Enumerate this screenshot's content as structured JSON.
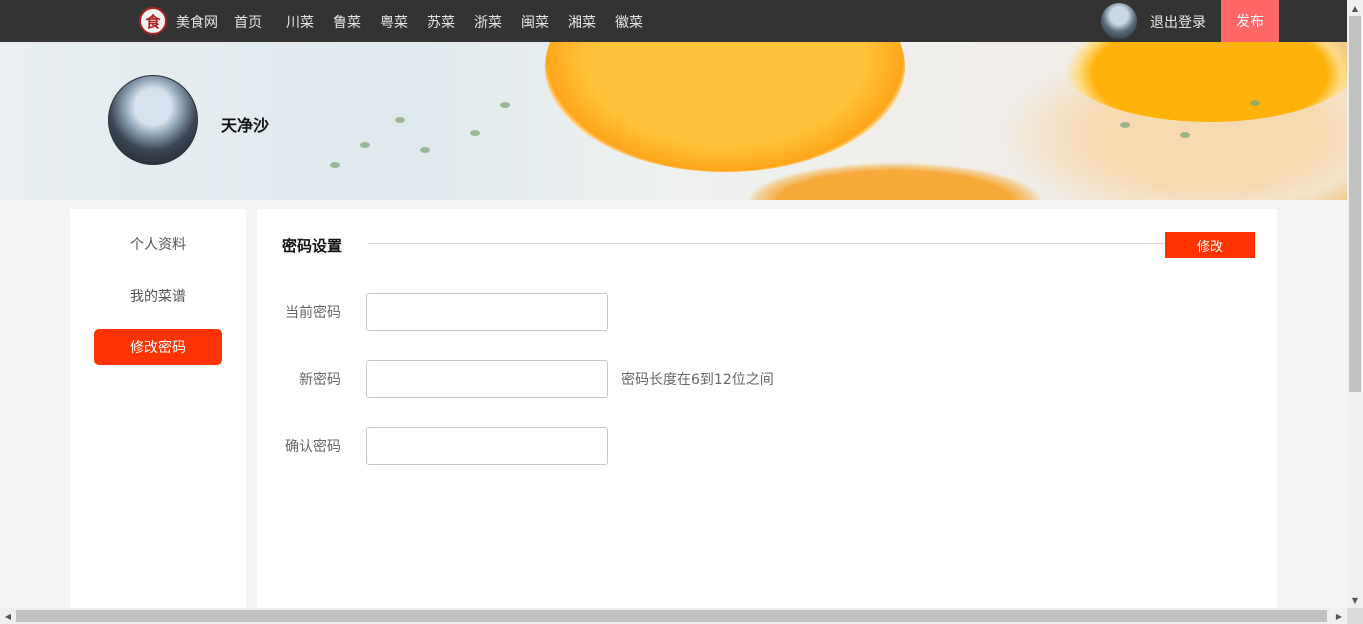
{
  "header": {
    "logo_glyph": "食",
    "site_name": "美食网",
    "nav": [
      "首页",
      "川菜",
      "鲁菜",
      "粤菜",
      "苏菜",
      "浙菜",
      "闽菜",
      "湘菜",
      "徽菜"
    ],
    "logout": "退出登录",
    "publish": "发布"
  },
  "profile": {
    "username": "天净沙"
  },
  "sidebar": {
    "items": [
      {
        "label": "个人资料",
        "active": false
      },
      {
        "label": "我的菜谱",
        "active": false
      },
      {
        "label": "修改密码",
        "active": true
      }
    ]
  },
  "panel": {
    "title": "密码设置",
    "edit_label": "修改",
    "fields": [
      {
        "label": "当前密码",
        "value": ""
      },
      {
        "label": "新密码",
        "value": ""
      },
      {
        "label": "确认密码",
        "value": ""
      }
    ],
    "hint": "密码长度在6到12位之间"
  },
  "colors": {
    "topbar": "#333333",
    "accent": "#ff3300",
    "publish": "#ff6666"
  },
  "icons": {
    "logo": "site-logo-icon",
    "scroll_up": "▲",
    "scroll_down": "▼",
    "scroll_left": "◀",
    "scroll_right": "▶"
  }
}
